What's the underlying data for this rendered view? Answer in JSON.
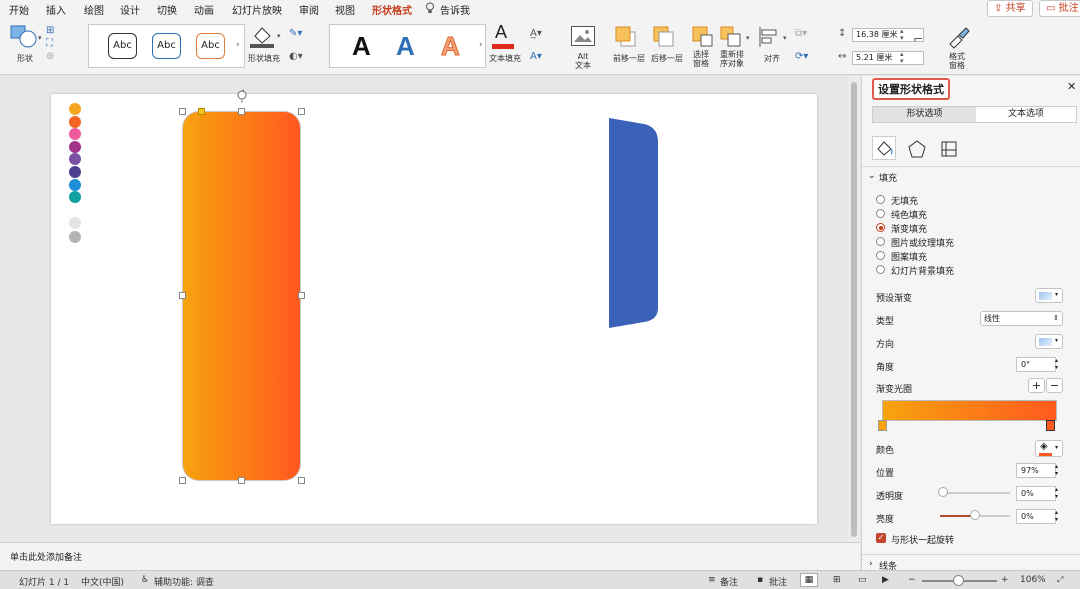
{
  "menu": {
    "tabs": [
      "开始",
      "插入",
      "绘图",
      "设计",
      "切换",
      "动画",
      "幻灯片放映",
      "审阅",
      "视图",
      "形状格式"
    ],
    "active_tab": "形状格式",
    "tell_me": "告诉我",
    "share": "共享",
    "comments": "批注"
  },
  "ribbon": {
    "shape": "形状",
    "style_abc": [
      "Abc",
      "Abc",
      "Abc"
    ],
    "shape_fill": "形状填充",
    "wordart_a": [
      "A",
      "A",
      "A"
    ],
    "text_fill": "文本填充",
    "alt_text": "Alt\n文本",
    "bring_forward": "前移一层",
    "send_backward": "后移一层",
    "selection_pane": "选择\n窗格",
    "reorder": "重新排\n序对象",
    "align": "对齐",
    "height": "16.38 厘米",
    "width": "5.21 厘米",
    "format_pane": "格式\n窗格"
  },
  "slide": {
    "swatch_colors": [
      "#f5a623",
      "#f26522",
      "#ef5b9c",
      "#a0348a",
      "#7b52a3",
      "#4b3f8f",
      "#1a8fd8",
      "#12a0a0",
      "#e4e4e4",
      "#b3b3b3"
    ],
    "gradient": {
      "start": "#f7a30f",
      "end": "#ff5a1e"
    },
    "blue_shape_color": "#3a62b8"
  },
  "notes_placeholder": "单击此处添加备注",
  "pane": {
    "title": "设置形状格式",
    "tab_shape": "形状选项",
    "tab_text": "文本选项",
    "fill_header": "填充",
    "fill_options": [
      "无填充",
      "纯色填充",
      "渐变填充",
      "图片或纹理填充",
      "图案填充",
      "幻灯片背景填充"
    ],
    "selected_fill": "渐变填充",
    "preset_gradient": "预设渐变",
    "type_label": "类型",
    "type_value": "线性",
    "direction": "方向",
    "angle_label": "角度",
    "angle_value": "0°",
    "gradient_stops": "渐变光圈",
    "color_label": "颜色",
    "position_label": "位置",
    "position_value": "97%",
    "transparency_label": "透明度",
    "transparency_value": "0%",
    "brightness_label": "亮度",
    "brightness_value": "0%",
    "rotate_with_shape": "与形状一起旋转",
    "line_header": "线条"
  },
  "status": {
    "slide_counter": "幻灯片 1 / 1",
    "language": "中文(中国)",
    "accessibility": "辅助功能: 调查",
    "notes": "备注",
    "comments": "批注",
    "zoom": "106%"
  }
}
